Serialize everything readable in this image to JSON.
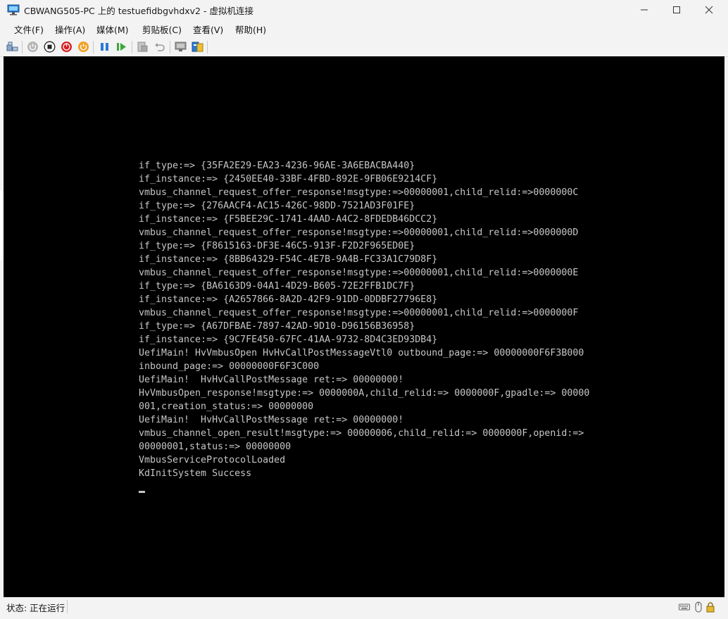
{
  "window": {
    "title": "CBWANG505-PC 上的 testuefidbgvhdxv2 - 虚拟机连接",
    "minimize_glyph": "—",
    "maximize_glyph": "☐",
    "close_glyph": "✕"
  },
  "menu": {
    "items": [
      "文件(F)",
      "操作(A)",
      "媒体(M)",
      "剪贴板(C)",
      "查看(V)",
      "帮助(H)"
    ]
  },
  "toolbar": {
    "icons": [
      "ctrl-alt-del-icon",
      "start-icon",
      "turn-off-icon",
      "shutdown-icon",
      "save-icon",
      "pause-icon",
      "resume-icon",
      "checkpoint-icon",
      "revert-icon",
      "enhanced-session-icon",
      "share-icon"
    ]
  },
  "console": {
    "lines": [
      "if_type:=> {35FA2E29-EA23-4236-96AE-3A6EBACBA440}",
      "if_instance:=> {2450EE40-33BF-4FBD-892E-9FB06E9214CF}",
      "vmbus_channel_request_offer_response!msgtype:=>00000001,child_relid:=>0000000C",
      "if_type:=> {276AACF4-AC15-426C-98DD-7521AD3F01FE}",
      "if_instance:=> {F5BEE29C-1741-4AAD-A4C2-8FDEDB46DCC2}",
      "vmbus_channel_request_offer_response!msgtype:=>00000001,child_relid:=>0000000D",
      "if_type:=> {F8615163-DF3E-46C5-913F-F2D2F965ED0E}",
      "if_instance:=> {8BB64329-F54C-4E7B-9A4B-FC33A1C79D8F}",
      "vmbus_channel_request_offer_response!msgtype:=>00000001,child_relid:=>0000000E",
      "if_type:=> {BA6163D9-04A1-4D29-B605-72E2FFB1DC7F}",
      "if_instance:=> {A2657866-8A2D-42F9-91DD-0DDBF27796E8}",
      "vmbus_channel_request_offer_response!msgtype:=>00000001,child_relid:=>0000000F",
      "if_type:=> {A67DFBAE-7897-42AD-9D10-D96156B36958}",
      "if_instance:=> {9C7FE450-67FC-41AA-9732-8D4C3ED93DB4}",
      "UefiMain! HvVmbusOpen HvHvCallPostMessageVtl0 outbound_page:=> 00000000F6F3B000",
      "inbound_page:=> 00000000F6F3C000",
      "UefiMain!  HvHvCallPostMessage ret:=> 00000000!",
      "HvVmbusOpen_response!msgtype:=> 0000000A,child_relid:=> 0000000F,gpadle:=> 00000",
      "001,creation_status:=> 00000000",
      "UefiMain!  HvHvCallPostMessage ret:=> 00000000!",
      "vmbus_channel_open_result!msgtype:=> 00000006,child_relid:=> 0000000F,openid:=>",
      "00000001,status:=> 00000000",
      "VmbusServiceProtocolLoaded",
      "KdInitSystem Success"
    ]
  },
  "status": {
    "text": "状态: 正在运行",
    "icons": [
      "keyboard-icon",
      "mouse-icon",
      "lock-icon"
    ]
  }
}
